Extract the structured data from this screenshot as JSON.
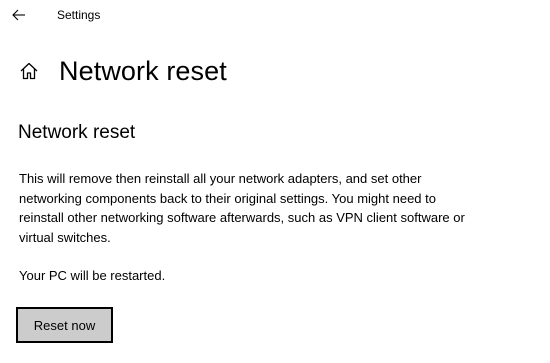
{
  "titlebar": {
    "back_icon": "arrow-left-icon",
    "app_title": "Settings"
  },
  "header": {
    "home_icon": "home-icon",
    "page_title": "Network reset"
  },
  "content": {
    "section_title": "Network reset",
    "description": "This will remove then reinstall all your network adapters, and set other networking components back to their original settings. You might need to reinstall other networking software afterwards, such as VPN client software or virtual switches.",
    "restart_note": "Your PC will be restarted.",
    "reset_button_label": "Reset now"
  },
  "colors": {
    "background": "#ffffff",
    "text": "#000000",
    "button_background": "#cccccc",
    "button_border": "#000000"
  }
}
